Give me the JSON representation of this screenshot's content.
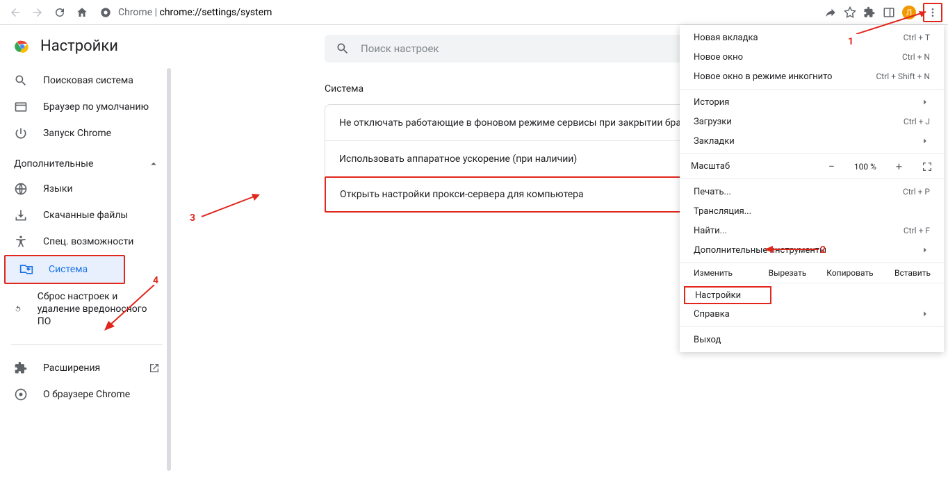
{
  "toolbar": {
    "url_prefix": "Chrome",
    "url_sep": " | ",
    "url": "chrome://settings/system",
    "avatar_letter": "Л"
  },
  "sidebar": {
    "title": "Настройки",
    "items": [
      {
        "label": "Поисковая система"
      },
      {
        "label": "Браузер по умолчанию"
      },
      {
        "label": "Запуск Chrome"
      }
    ],
    "advanced": "Дополнительные",
    "adv_items": [
      {
        "label": "Языки"
      },
      {
        "label": "Скачанные файлы"
      },
      {
        "label": "Спец. возможности"
      },
      {
        "label": "Система"
      },
      {
        "label": "Сброс настроек и удаление вредоносного ПО"
      }
    ],
    "footer": [
      {
        "label": "Расширения"
      },
      {
        "label": "О браузере Chrome"
      }
    ]
  },
  "main": {
    "search_ph": "Поиск настроек",
    "section": "Система",
    "rows": [
      "Не отключать работающие в фоновом режиме сервисы при закрытии браузера",
      "Использовать аппаратное ускорение (при наличии)",
      "Открыть настройки прокси-сервера для компьютера"
    ]
  },
  "menu": {
    "new_tab": {
      "l": "Новая вкладка",
      "s": "Ctrl + T"
    },
    "new_win": {
      "l": "Новое окно",
      "s": "Ctrl + N"
    },
    "incog": {
      "l": "Новое окно в режиме инкогнито",
      "s": "Ctrl + Shift + N"
    },
    "history": {
      "l": "История"
    },
    "downloads": {
      "l": "Загрузки",
      "s": "Ctrl + J"
    },
    "bookmarks": {
      "l": "Закладки"
    },
    "zoom_l": "Масштаб",
    "zoom_v": "100 %",
    "print": {
      "l": "Печать...",
      "s": "Ctrl + P"
    },
    "cast": {
      "l": "Трансляция..."
    },
    "find": {
      "l": "Найти...",
      "s": "Ctrl + F"
    },
    "moretools": {
      "l": "Дополнительные инструменты"
    },
    "edit": {
      "h": "Изменить",
      "cut": "Вырезать",
      "copy": "Копировать",
      "paste": "Вставить"
    },
    "settings": {
      "l": "Настройки"
    },
    "help": {
      "l": "Справка"
    },
    "exit": {
      "l": "Выход"
    }
  },
  "ann": {
    "1": "1",
    "2": "2",
    "3": "3",
    "4": "4"
  }
}
